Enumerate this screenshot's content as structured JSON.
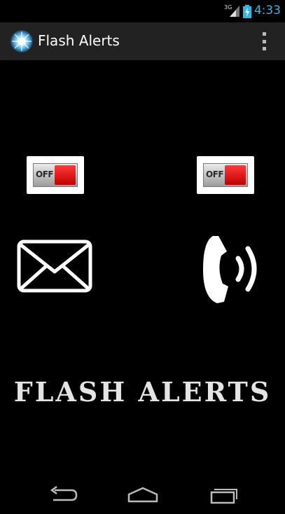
{
  "status_bar": {
    "network": "3G",
    "time": "4:33"
  },
  "action_bar": {
    "title": "Flash Alerts",
    "app_icon": "flash-burst-icon",
    "menu_icon": "overflow-menu-icon"
  },
  "toggles": {
    "sms": {
      "label": "OFF",
      "state": "off"
    },
    "call": {
      "label": "OFF",
      "state": "off"
    }
  },
  "icons": {
    "sms": "envelope-icon",
    "call": "phone-ringing-icon"
  },
  "banner": {
    "text": "FLASH ALERTS"
  },
  "nav_bar": {
    "back": "back-icon",
    "home": "home-icon",
    "recents": "recents-icon"
  },
  "colors": {
    "background": "#000000",
    "action_bar": "#222222",
    "clock": "#33b5e5",
    "toggle_off": "#d40000"
  }
}
